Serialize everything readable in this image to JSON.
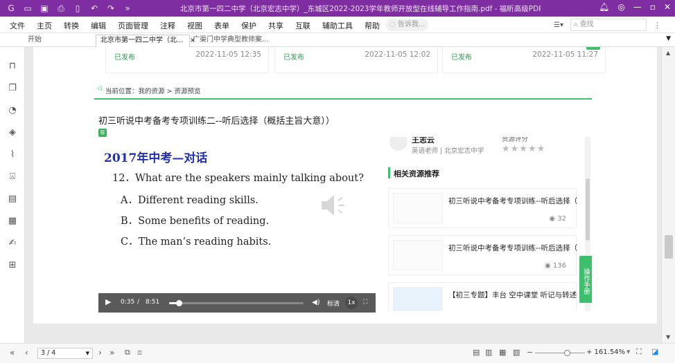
{
  "window": {
    "title": "北京市第一四二中学（北京宏志中学）_东城区2022-2023学年教师开放型在线辅导工作指南.pdf - 福昕高级PDF编辑器"
  },
  "menu": {
    "items": [
      "文件",
      "主页",
      "转换",
      "编辑",
      "页面管理",
      "注释",
      "视图",
      "表单",
      "保护",
      "共享",
      "互联",
      "辅助工具",
      "帮助"
    ],
    "search_hint": "告诉我...",
    "find_placeholder": "查找"
  },
  "tabs": [
    {
      "label": "开始"
    },
    {
      "label": "北京市第一四二中学（北...",
      "close": "×"
    },
    {
      "label": "广渠门中学典型教师案..."
    }
  ],
  "cards": [
    {
      "status": "已发布",
      "date": "2022-11-05 12:35"
    },
    {
      "status": "已发布",
      "date": "2022-11-05 12:02"
    },
    {
      "status": "已发布",
      "date": "2022-11-05 11:27"
    }
  ],
  "breadcrumb": "当前位置：我的资源 > 资源预览",
  "resource": {
    "title": "初三听说中考备考专项训练二--听后选择（概括主旨大意））",
    "badge": "荐"
  },
  "media": {
    "heading": "2017年中考—对话",
    "question": "12．What are the speakers mainly talking about?",
    "options": [
      "A．Different reading skills.",
      "B．Some benefits of reading.",
      "C．The man’s reading habits."
    ],
    "player": {
      "current": "0:35",
      "sep": "/",
      "duration": "8:51",
      "quality": "标清",
      "speed": "1x",
      "progress": 0.07
    }
  },
  "author": {
    "name": "王志云",
    "role": "英语老师 | 北京宏志中学",
    "rating_label": "资源评分",
    "stars": "★★★★★"
  },
  "related": {
    "heading": "相关资源推荐",
    "items": [
      {
        "title": "初三听说中考备考专项训练--听后选择（信息推断）",
        "views": "32"
      },
      {
        "title": "初三听说中考备考专项训练--听后选择（综合推断）",
        "views": "136"
      },
      {
        "title": "【初三专题】丰台 空中课堂 听记与转述信息能力"
      }
    ]
  },
  "helper_label": "操作手册",
  "status": {
    "page": "3 / 4",
    "zoom": "+ 161.54%"
  },
  "colors": {
    "titlebar": "#7e2ea0",
    "accent": "#3dbf6c",
    "heading_blue": "#1f2fae"
  }
}
